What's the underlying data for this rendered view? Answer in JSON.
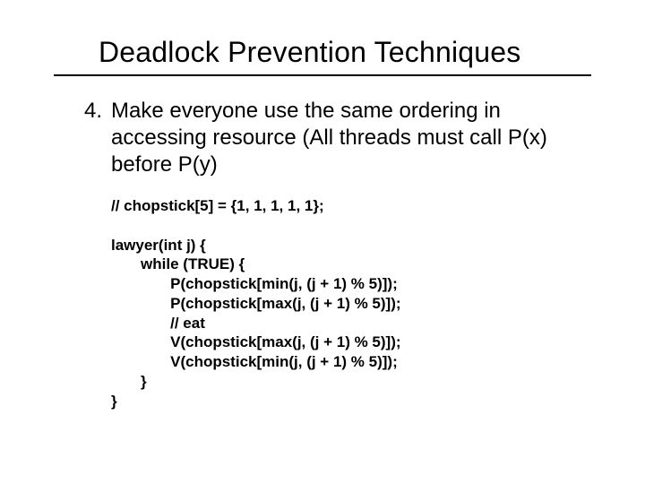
{
  "title": "Deadlock Prevention Techniques",
  "item": {
    "number": "4.",
    "text": "Make everyone use the same ordering in accessing resource (All threads must call P(x) before P(y)"
  },
  "code": {
    "l1": "// chopstick[5] = {1, 1, 1, 1, 1};",
    "l2": "lawyer(int j) {",
    "l3": "       while (TRUE) {",
    "l4": "              P(chopstick[min(j, (j + 1) % 5)]);",
    "l5": "              P(chopstick[max(j, (j + 1) % 5)]);",
    "l6": "              // eat",
    "l7": "              V(chopstick[max(j, (j + 1) % 5)]);",
    "l8": "              V(chopstick[min(j, (j + 1) % 5)]);",
    "l9": "       }",
    "l10": "}"
  }
}
